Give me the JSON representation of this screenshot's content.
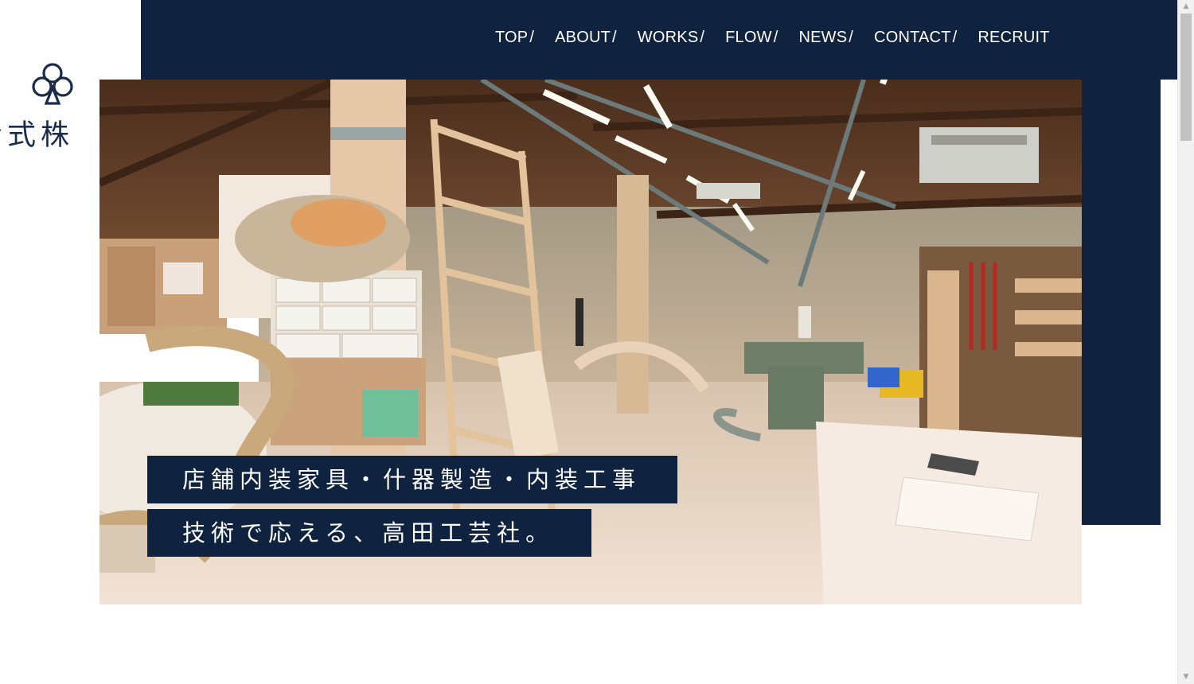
{
  "nav": {
    "items": [
      {
        "label": "TOP",
        "sep": "/"
      },
      {
        "label": "ABOUT",
        "sep": "/"
      },
      {
        "label": "WORKS",
        "sep": "/"
      },
      {
        "label": "FLOW",
        "sep": "/"
      },
      {
        "label": "NEWS",
        "sep": "/"
      },
      {
        "label": "CONTACT",
        "sep": "/"
      },
      {
        "label": "RECRUIT",
        "sep": ""
      }
    ]
  },
  "logo": {
    "icon": "club-trefoil-icon",
    "company_name": "株式会社高田工芸社"
  },
  "hero": {
    "tagline_line1": "店舗内装家具・什器製造・内装工事",
    "tagline_line2": "技術で応える、高田工芸社。"
  },
  "colors": {
    "navy": "#0f2240",
    "logo_text": "#1a2c4a",
    "white": "#ffffff"
  },
  "scrollbar": {
    "up_icon": "triangle-up-icon",
    "down_icon": "triangle-down-icon"
  }
}
